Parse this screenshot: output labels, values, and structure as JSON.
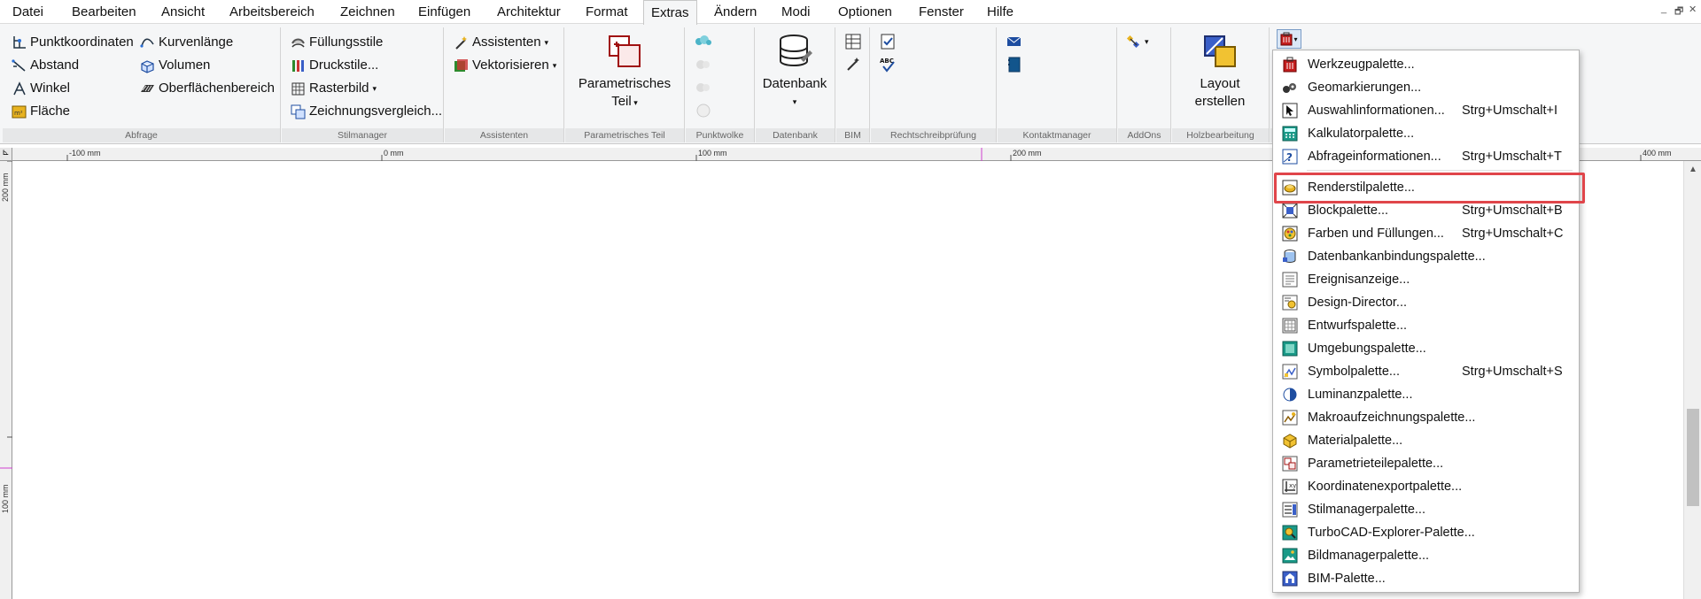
{
  "menubar": {
    "items": [
      "Datei",
      "Bearbeiten",
      "Ansicht",
      "Arbeitsbereich",
      "Zeichnen",
      "Einfügen",
      "Architektur",
      "Format",
      "Extras",
      "Ändern",
      "Modi",
      "Optionen",
      "Fenster",
      "Hilfe"
    ],
    "active": "Extras"
  },
  "window_controls": [
    "_",
    "🗗",
    "✕"
  ],
  "ribbon": {
    "abfrage": {
      "label": "Abfrage",
      "items": [
        "Punktkoordinaten",
        "Abstand",
        "Winkel",
        "Fläche",
        "Kurvenlänge",
        "Volumen",
        "Oberflächenbereich"
      ]
    },
    "stilmanager": {
      "label": "Stilmanager",
      "items": [
        "Füllungsstile",
        "Druckstile...",
        "Rasterbild",
        "Zeichnungsvergleich..."
      ]
    },
    "assistenten": {
      "label": "Assistenten",
      "items": [
        "Assistenten",
        "Vektorisieren"
      ]
    },
    "parametrisches_teil": {
      "label": "Parametrisches Teil",
      "button_line1": "Parametrisches",
      "button_line2": "Teil"
    },
    "punktwolke": {
      "label": "Punktwolke"
    },
    "datenbank": {
      "label": "Datenbank",
      "button": "Datenbank"
    },
    "bim": {
      "label": "BIM"
    },
    "rechtschreibpruefung": {
      "label": "Rechtschreibprüfung"
    },
    "kontaktmanager": {
      "label": "Kontaktmanager"
    },
    "addons": {
      "label": "AddOns"
    },
    "holzbearbeitung": {
      "label": "Holzbearbeitung",
      "button_line1": "Layout",
      "button_line2": "erstellen"
    }
  },
  "ruler": {
    "h_labels": [
      "-100 mm",
      "0 mm",
      "100 mm",
      "200 mm",
      "400 mm"
    ],
    "v_labels": [
      "200 mm",
      "100 mm"
    ]
  },
  "dropdown": {
    "items": [
      {
        "label": "Werkzeugpalette...",
        "shortcut": "",
        "icon": "toolbox-icon"
      },
      {
        "label": "Geomarkierungen...",
        "shortcut": "",
        "icon": "geo-markers-icon"
      },
      {
        "label": "Auswahlinformationen...",
        "shortcut": "Strg+Umschalt+I",
        "icon": "cursor-icon"
      },
      {
        "label": "Kalkulatorpalette...",
        "shortcut": "",
        "icon": "calculator-icon"
      },
      {
        "label": "Abfrageinformationen...",
        "shortcut": "Strg+Umschalt+T",
        "icon": "query-icon"
      },
      {
        "label": "Renderstilpalette...",
        "shortcut": "",
        "icon": "render-style-icon"
      },
      {
        "label": "Blockpalette...",
        "shortcut": "Strg+Umschalt+B",
        "icon": "block-icon"
      },
      {
        "label": "Farben und Füllungen...",
        "shortcut": "Strg+Umschalt+C",
        "icon": "colors-fills-icon"
      },
      {
        "label": "Datenbankanbindungspalette...",
        "shortcut": "",
        "icon": "database-link-icon"
      },
      {
        "label": "Ereignisanzeige...",
        "shortcut": "",
        "icon": "event-viewer-icon"
      },
      {
        "label": "Design-Director...",
        "shortcut": "",
        "icon": "design-director-icon"
      },
      {
        "label": "Entwurfspalette...",
        "shortcut": "",
        "icon": "draft-icon"
      },
      {
        "label": "Umgebungspalette...",
        "shortcut": "",
        "icon": "environment-icon"
      },
      {
        "label": "Symbolpalette...",
        "shortcut": "Strg+Umschalt+S",
        "icon": "symbol-icon"
      },
      {
        "label": "Luminanzpalette...",
        "shortcut": "",
        "icon": "luminance-icon"
      },
      {
        "label": "Makroaufzeichnungspalette...",
        "shortcut": "",
        "icon": "macro-record-icon"
      },
      {
        "label": "Materialpalette...",
        "shortcut": "",
        "icon": "material-icon"
      },
      {
        "label": "Parametrieteilepalette...",
        "shortcut": "",
        "icon": "parametric-parts-icon"
      },
      {
        "label": "Koordinatenexportpalette...",
        "shortcut": "",
        "icon": "coordinate-export-icon"
      },
      {
        "label": "Stilmanagerpalette...",
        "shortcut": "",
        "icon": "style-manager-icon"
      },
      {
        "label": "TurboCAD-Explorer-Palette...",
        "shortcut": "",
        "icon": "explorer-icon"
      },
      {
        "label": "Bildmanagerpalette...",
        "shortcut": "",
        "icon": "image-manager-icon"
      },
      {
        "label": "BIM-Palette...",
        "shortcut": "",
        "icon": "bim-icon"
      }
    ],
    "highlighted": "Renderstilpalette..."
  },
  "colors": {
    "highlight": "#e0454a",
    "ribbon_bg": "#f5f6f7",
    "group_label_bg": "#e6e7e8"
  }
}
